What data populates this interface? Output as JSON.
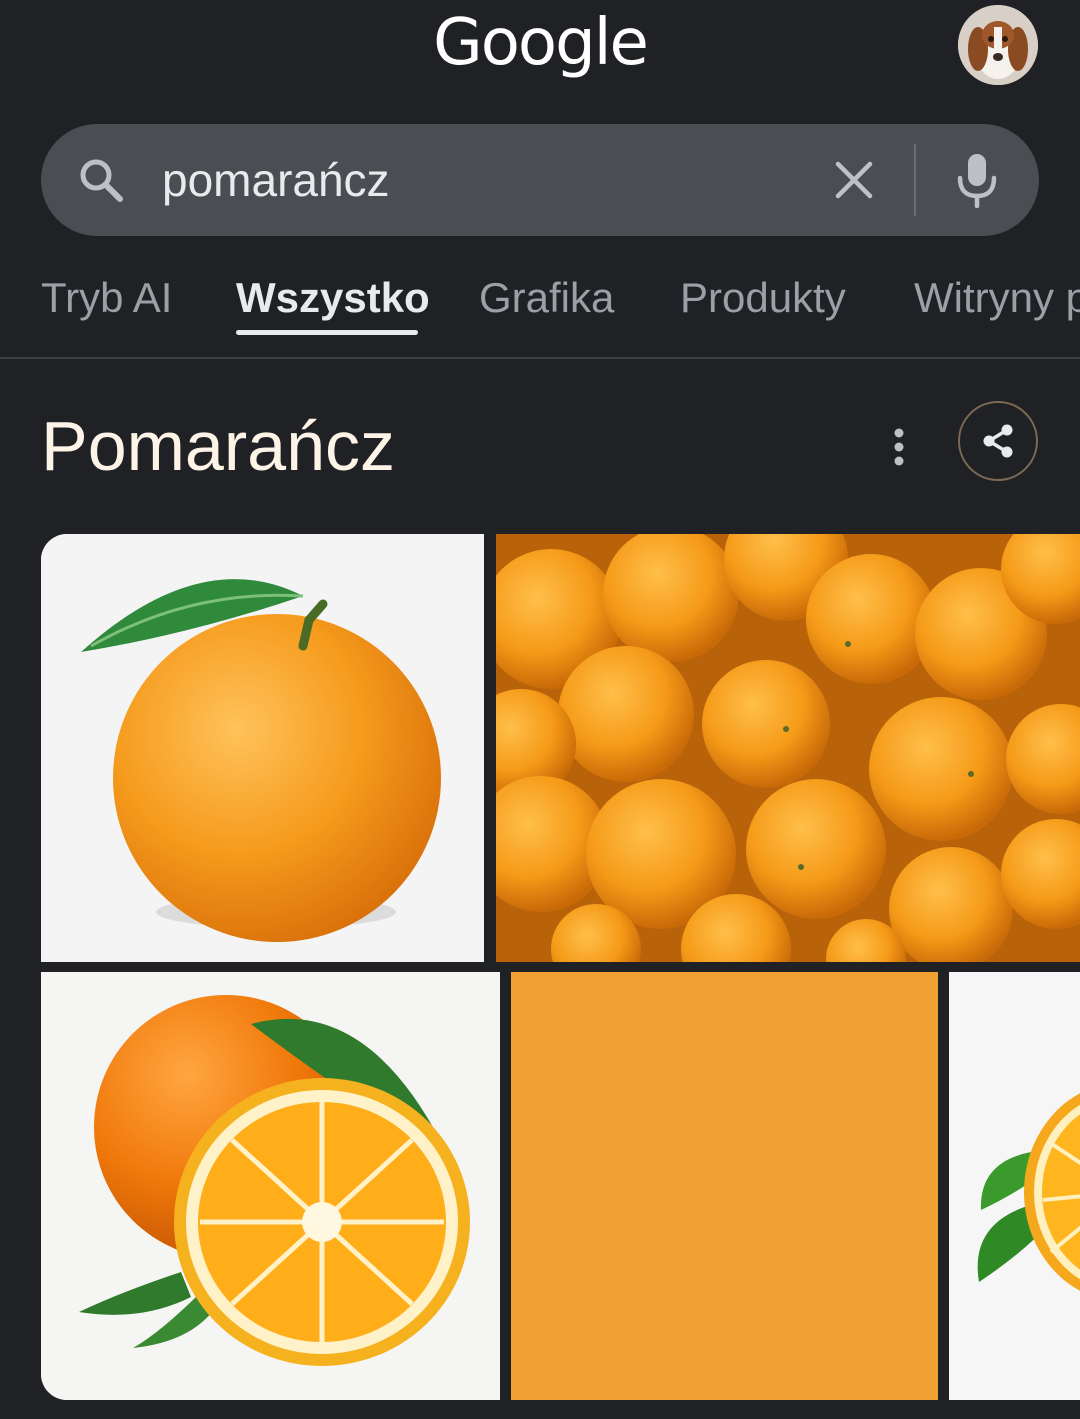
{
  "header": {
    "logo_text": "Google",
    "avatar_label": "account-avatar"
  },
  "search": {
    "query": "pomarańcz",
    "placeholder": ""
  },
  "tabs": [
    {
      "label": "Tryb AI",
      "active": false
    },
    {
      "label": "Wszystko",
      "active": true
    },
    {
      "label": "Grafika",
      "active": false
    },
    {
      "label": "Produkty",
      "active": false
    },
    {
      "label": "Witryny p",
      "active": false
    }
  ],
  "knowledge_panel": {
    "title": "Pomarańcz"
  },
  "images": [
    {
      "subject": "single orange with leaf"
    },
    {
      "subject": "pile of oranges"
    },
    {
      "subject": "orange with halved orange and leaves"
    },
    {
      "subject": "orange color swatch"
    },
    {
      "subject": "halved orange with leaves"
    }
  ],
  "colors": {
    "background": "#202124",
    "search_bar": "#4a4e52",
    "title": "#fdf3e7",
    "swatch": "#f0a132"
  },
  "icons": [
    "search-icon",
    "clear-icon",
    "mic-icon",
    "more-vert-icon",
    "share-icon"
  ]
}
